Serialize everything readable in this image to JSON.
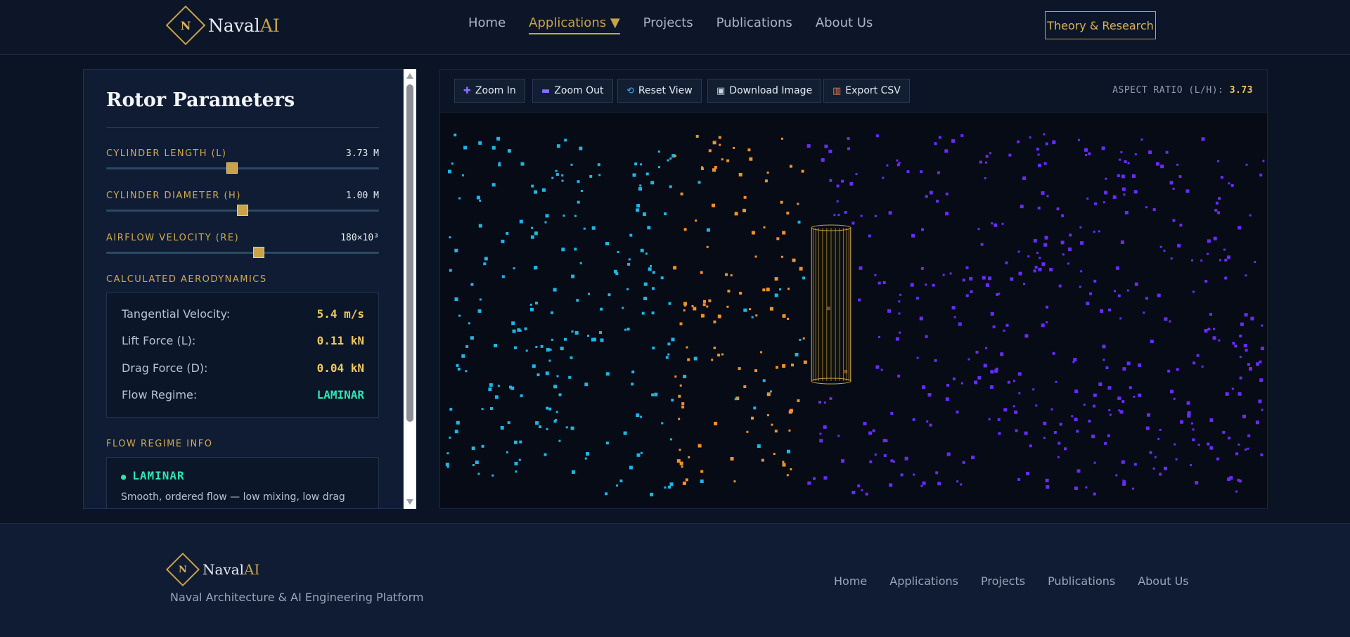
{
  "brand": {
    "name": "Naval",
    "suffix": "AI",
    "mark": "N"
  },
  "nav": {
    "items": [
      "Home",
      "Applications ▼",
      "Projects",
      "Publications",
      "About Us"
    ],
    "active_index": 1,
    "cta": "Theory & Research"
  },
  "panel": {
    "title": "Rotor Parameters",
    "params": [
      {
        "label": "CYLINDER LENGTH (L)",
        "value": "3.73 M",
        "fraction": 0.46
      },
      {
        "label": "CYLINDER DIAMETER (H)",
        "value": "1.00 M",
        "fraction": 0.5
      },
      {
        "label": "AIRFLOW VELOCITY (RE)",
        "value": "180×10³",
        "fraction": 0.56
      }
    ],
    "aero_section": "CALCULATED AERODYNAMICS",
    "aero": [
      {
        "label": "Tangential Velocity:",
        "value": "5.4 m/s"
      },
      {
        "label": "Lift Force (L):",
        "value": "0.11 kN"
      },
      {
        "label": "Drag Force (D):",
        "value": "0.04 kN"
      },
      {
        "label": "Flow Regime:",
        "value": "LAMINAR"
      }
    ],
    "regime_section": "FLOW REGIME INFO",
    "regime": {
      "name": "LAMINAR",
      "bullet": "●",
      "desc": "Smooth, ordered flow — low mixing, low drag"
    }
  },
  "viewer": {
    "buttons": [
      {
        "label": "Zoom In",
        "icon": "plus-icon"
      },
      {
        "label": "Zoom Out",
        "icon": "minus-icon"
      },
      {
        "label": "Reset View",
        "icon": "reset-icon"
      },
      {
        "label": "Download Image",
        "icon": "camera-icon"
      },
      {
        "label": "Export CSV",
        "icon": "chart-icon"
      }
    ],
    "aspect_label": "ASPECT RATIO (L/H):",
    "aspect_value": "3.73",
    "colors": {
      "upstream": "#1fb5e6",
      "near": "#f0922a",
      "downstream": "#6a2bff",
      "cylinder": "#c9a24a"
    }
  },
  "footer": {
    "tagline": "Naval Architecture & AI Engineering Platform",
    "links": [
      "Home",
      "Applications",
      "Projects",
      "Publications",
      "About Us"
    ]
  }
}
